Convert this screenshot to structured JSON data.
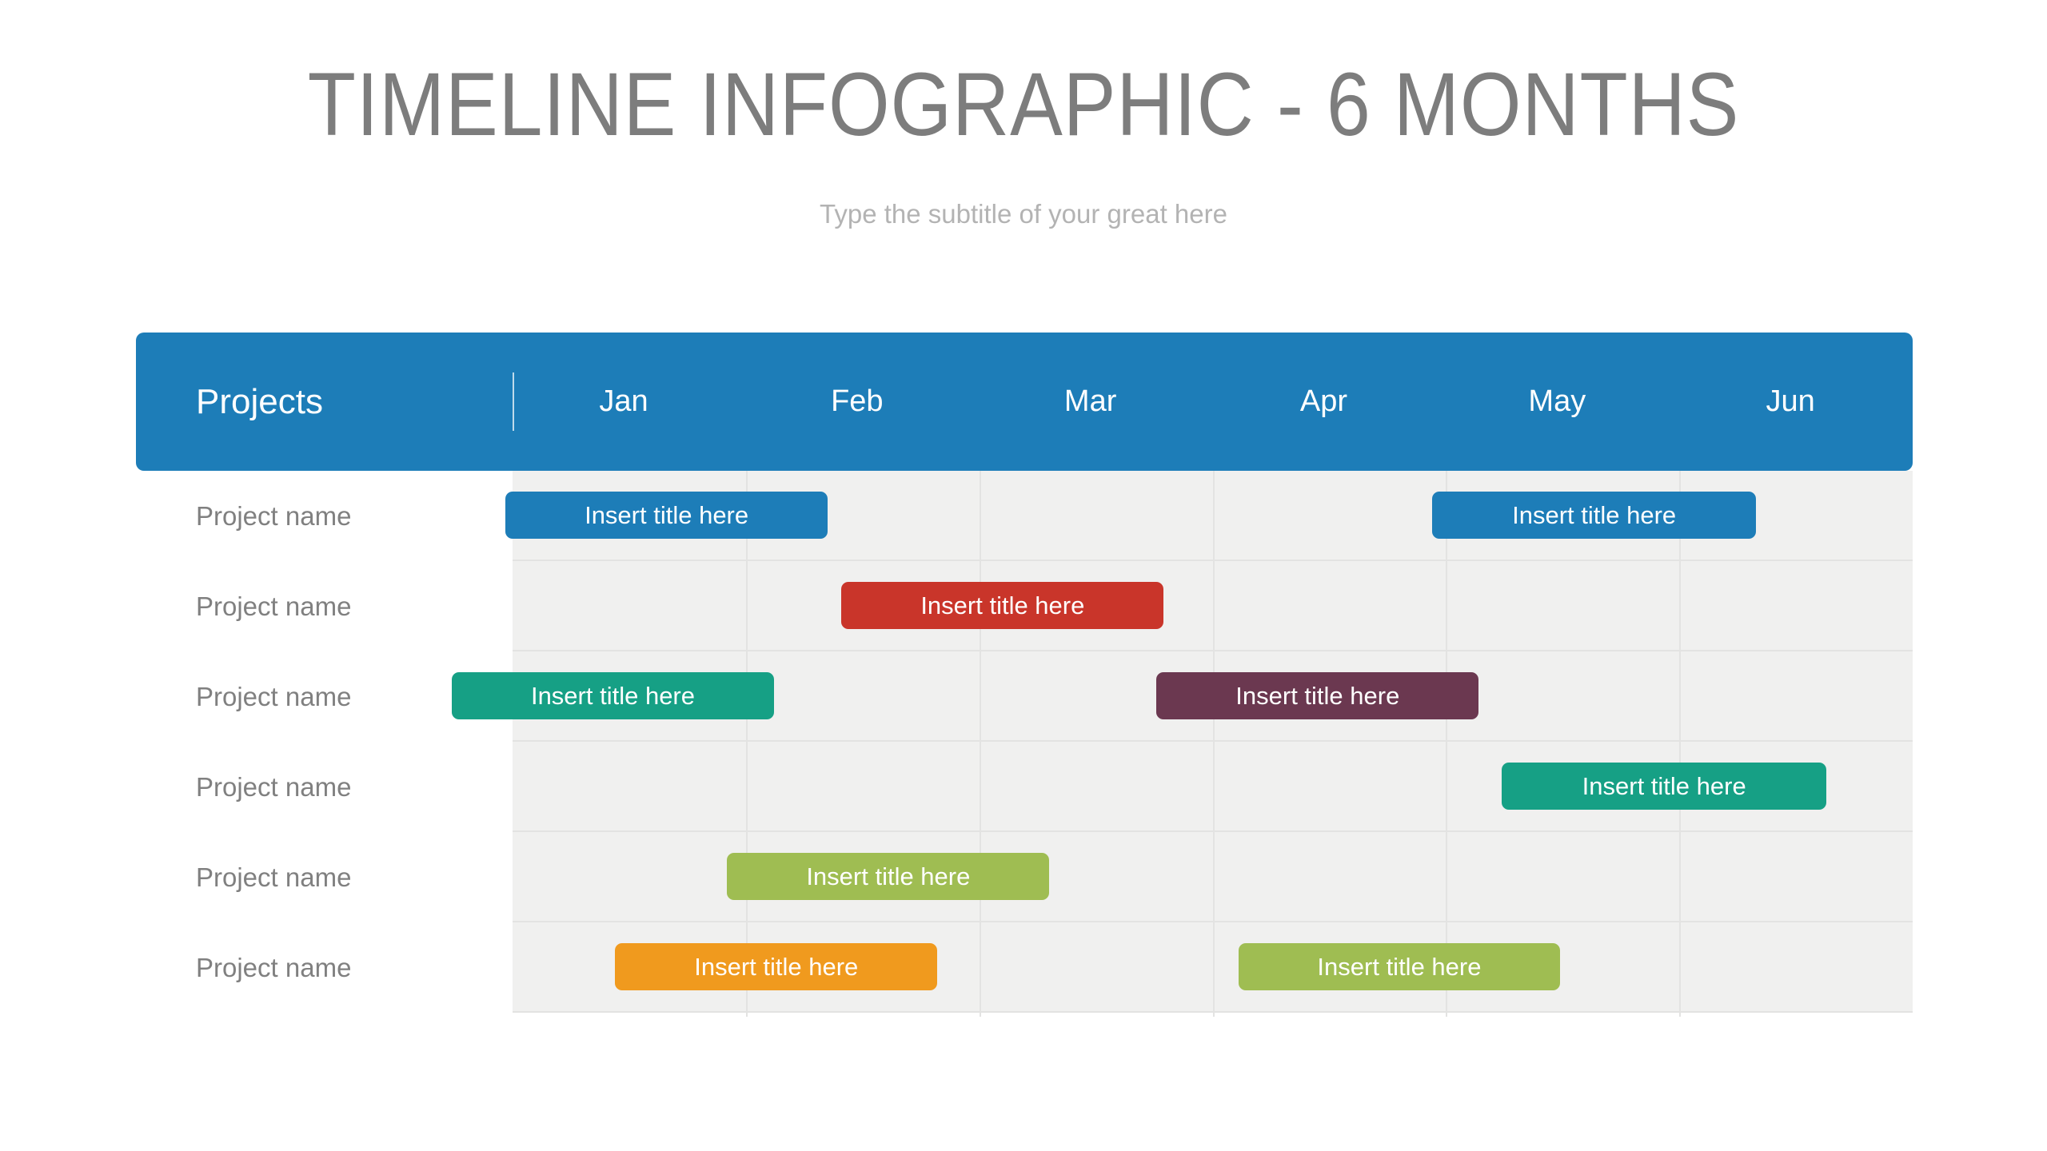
{
  "heading": {
    "title": "TIMELINE INFOGRAPHIC - 6 MONTHS",
    "subtitle": "Type the subtitle of your great here"
  },
  "header": {
    "projects_label": "Projects",
    "months": [
      "Jan",
      "Feb",
      "Mar",
      "Apr",
      "May",
      "Jun"
    ],
    "background_color": "#1d7db8",
    "text_color": "#ffffff"
  },
  "grid": {
    "row_background": "#f0f0ef",
    "line_color": "#e3e3e2",
    "row_count": 6,
    "column_count": 6
  },
  "rows": [
    {
      "label": "Project name",
      "bars": [
        {
          "title": "Insert title here",
          "color": "#1d7db8",
          "start_month": 0.97,
          "end_month": 2.35
        },
        {
          "title": "Insert title here",
          "color": "#1d7db8",
          "start_month": 4.94,
          "end_month": 6.33
        }
      ]
    },
    {
      "label": "Project name",
      "bars": [
        {
          "title": "Insert title here",
          "color": "#c9352a",
          "start_month": 2.41,
          "end_month": 3.79
        }
      ]
    },
    {
      "label": "Project name",
      "bars": [
        {
          "title": "Insert title here",
          "color": "#16a085",
          "start_month": 0.74,
          "end_month": 2.12
        },
        {
          "title": "Insert title here",
          "color": "#6b3850",
          "start_month": 3.76,
          "end_month": 5.14
        }
      ]
    },
    {
      "label": "Project name",
      "bars": [
        {
          "title": "Insert title here",
          "color": "#16a085",
          "start_month": 5.24,
          "end_month": 6.63
        }
      ]
    },
    {
      "label": "Project name",
      "bars": [
        {
          "title": "Insert title here",
          "color": "#9fbd52",
          "start_month": 1.92,
          "end_month": 3.3
        }
      ]
    },
    {
      "label": "Project name",
      "bars": [
        {
          "title": "Insert title here",
          "color": "#f09a1e",
          "start_month": 1.44,
          "end_month": 2.82
        },
        {
          "title": "Insert title here",
          "color": "#9fbd52",
          "start_month": 4.11,
          "end_month": 5.49
        }
      ]
    }
  ],
  "chart_data": {
    "type": "bar",
    "title": "TIMELINE INFOGRAPHIC - 6 MONTHS",
    "subtitle": "Type the subtitle of your great here",
    "xlabel": "",
    "ylabel": "Projects",
    "categories": [
      "Jan",
      "Feb",
      "Mar",
      "Apr",
      "May",
      "Jun"
    ],
    "grid": true,
    "legend": "none",
    "series": [
      {
        "name": "Project name",
        "values": [
          {
            "label": "Insert title here",
            "start": 0.97,
            "end": 2.35,
            "color": "#1d7db8"
          },
          {
            "label": "Insert title here",
            "start": 4.94,
            "end": 6.33,
            "color": "#1d7db8"
          }
        ]
      },
      {
        "name": "Project name",
        "values": [
          {
            "label": "Insert title here",
            "start": 2.41,
            "end": 3.79,
            "color": "#c9352a"
          }
        ]
      },
      {
        "name": "Project name",
        "values": [
          {
            "label": "Insert title here",
            "start": 0.74,
            "end": 2.12,
            "color": "#16a085"
          },
          {
            "label": "Insert title here",
            "start": 3.76,
            "end": 5.14,
            "color": "#6b3850"
          }
        ]
      },
      {
        "name": "Project name",
        "values": [
          {
            "label": "Insert title here",
            "start": 5.24,
            "end": 6.63,
            "color": "#16a085"
          }
        ]
      },
      {
        "name": "Project name",
        "values": [
          {
            "label": "Insert title here",
            "start": 1.92,
            "end": 3.3,
            "color": "#9fbd52"
          }
        ]
      },
      {
        "name": "Project name",
        "values": [
          {
            "label": "Insert title here",
            "start": 1.44,
            "end": 2.82,
            "color": "#f09a1e"
          },
          {
            "label": "Insert title here",
            "start": 4.11,
            "end": 5.49,
            "color": "#9fbd52"
          }
        ]
      }
    ]
  }
}
